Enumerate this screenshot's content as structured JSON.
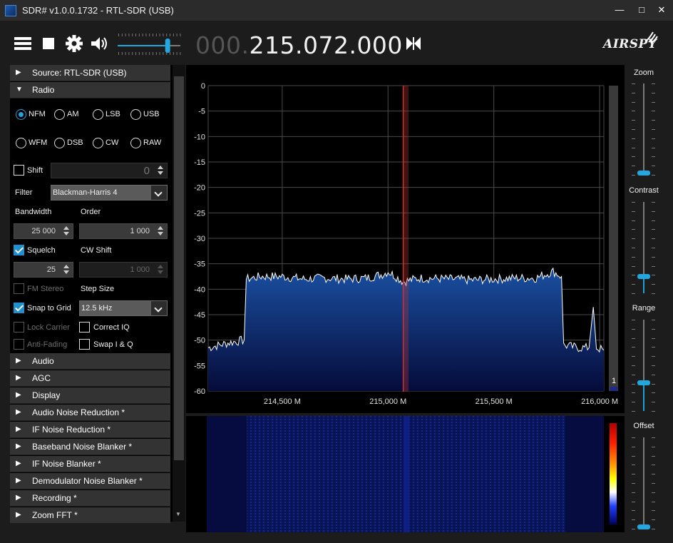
{
  "window": {
    "title": "SDR# v1.0.0.1732 - RTL-SDR (USB)",
    "minimize_glyph": "—",
    "maximize_glyph": "□",
    "close_glyph": "✕"
  },
  "toolbar": {
    "menu_icon": "hamburger-icon",
    "stop_icon": "stop-icon",
    "settings_icon": "gear-icon",
    "audio_icon": "speaker-icon",
    "volume_level": 0.85,
    "frequency_prefix": "000.",
    "frequency_main": "215.072.000",
    "swap_icon": "bowtie-swap-icon",
    "brand": "AIRSPY"
  },
  "sections": {
    "source": {
      "arrow": "▶",
      "label": "Source: RTL-SDR (USB)"
    },
    "radio": {
      "arrow": "▼",
      "label": "Radio"
    },
    "collapsed": [
      {
        "arrow": "▶",
        "label": "Audio"
      },
      {
        "arrow": "▶",
        "label": "AGC"
      },
      {
        "arrow": "▶",
        "label": "Display"
      },
      {
        "arrow": "▶",
        "label": "Audio Noise Reduction *"
      },
      {
        "arrow": "▶",
        "label": "IF Noise Reduction *"
      },
      {
        "arrow": "▶",
        "label": "Baseband Noise Blanker *"
      },
      {
        "arrow": "▶",
        "label": "IF Noise Blanker *"
      },
      {
        "arrow": "▶",
        "label": "Demodulator Noise Blanker *"
      },
      {
        "arrow": "▶",
        "label": "Recording *"
      },
      {
        "arrow": "▶",
        "label": "Zoom FFT *"
      }
    ]
  },
  "radio": {
    "modes_row1": [
      "NFM",
      "AM",
      "LSB",
      "USB"
    ],
    "modes_row2": [
      "WFM",
      "DSB",
      "CW",
      "RAW"
    ],
    "selected_mode": "NFM",
    "shift": {
      "label": "Shift",
      "checked": false,
      "value": "0"
    },
    "filter": {
      "label": "Filter",
      "value": "Blackman-Harris 4"
    },
    "bandwidth": {
      "label": "Bandwidth",
      "value": "25 000"
    },
    "order": {
      "label": "Order",
      "value": "1 000"
    },
    "squelch": {
      "label": "Squelch",
      "checked": true,
      "value": "25"
    },
    "cw_shift": {
      "label": "CW Shift",
      "value": "1 000"
    },
    "fm_stereo": {
      "label": "FM Stereo",
      "checked": false
    },
    "step_size": {
      "label": "Step Size",
      "value": "12.5 kHz"
    },
    "snap_to_grid": {
      "label": "Snap to Grid",
      "checked": true
    },
    "lock_carrier": {
      "label": "Lock Carrier",
      "checked": false
    },
    "correct_iq": {
      "label": "Correct IQ",
      "checked": false
    },
    "anti_fading": {
      "label": "Anti-Fading",
      "checked": false
    },
    "swap_iq": {
      "label": "Swap I & Q",
      "checked": false
    }
  },
  "chart_data": {
    "type": "line",
    "title": "",
    "xlabel": "",
    "ylabel": "",
    "ylim": [
      -60,
      0
    ],
    "yticks": [
      0,
      -5,
      -10,
      -15,
      -20,
      -25,
      -30,
      -35,
      -40,
      -45,
      -50,
      -55,
      -60
    ],
    "xlim": [
      214150000,
      216020000
    ],
    "xticks": [
      {
        "value": 214500000,
        "label": "214,500 M"
      },
      {
        "value": 215000000,
        "label": "215,000 M"
      },
      {
        "value": 215500000,
        "label": "215,500 M"
      },
      {
        "value": 216000000,
        "label": "216,000 M"
      }
    ],
    "grid": true,
    "center_frequency": 215072000,
    "series": [
      {
        "x": [
          214150000,
          214250000,
          214320000,
          214330000,
          214400000,
          214500000,
          214600000,
          214700000,
          214800000,
          214900000,
          214980000,
          215000000,
          215072000,
          215150000,
          215300000,
          215400000,
          215500000,
          215600000,
          215700000,
          215780000,
          215820000,
          215830000,
          215900000,
          215950000,
          215970000,
          215985000,
          216020000
        ],
        "y": [
          -51.5,
          -50.5,
          -50,
          -38,
          -37.5,
          -37.5,
          -38,
          -37.8,
          -38,
          -37.8,
          -37,
          -36.5,
          -38.5,
          -37.8,
          -38,
          -38.2,
          -38,
          -37.8,
          -37.8,
          -36.5,
          -37.5,
          -51,
          -51.5,
          -51.5,
          -43.5,
          -51.5,
          -52
        ]
      }
    ],
    "level_readout": "1"
  },
  "right_sliders": [
    {
      "label": "Zoom",
      "level": 0.0
    },
    {
      "label": "Contrast",
      "level": 0.17
    },
    {
      "label": "Range",
      "level": 0.3
    },
    {
      "label": "Offset",
      "level": 0.0
    }
  ],
  "colors": {
    "accent": "#23a7dd",
    "spectrum_fill_top": "#1a4fa0",
    "spectrum_fill_bottom": "#050b3a",
    "marker": "#c0302a"
  }
}
